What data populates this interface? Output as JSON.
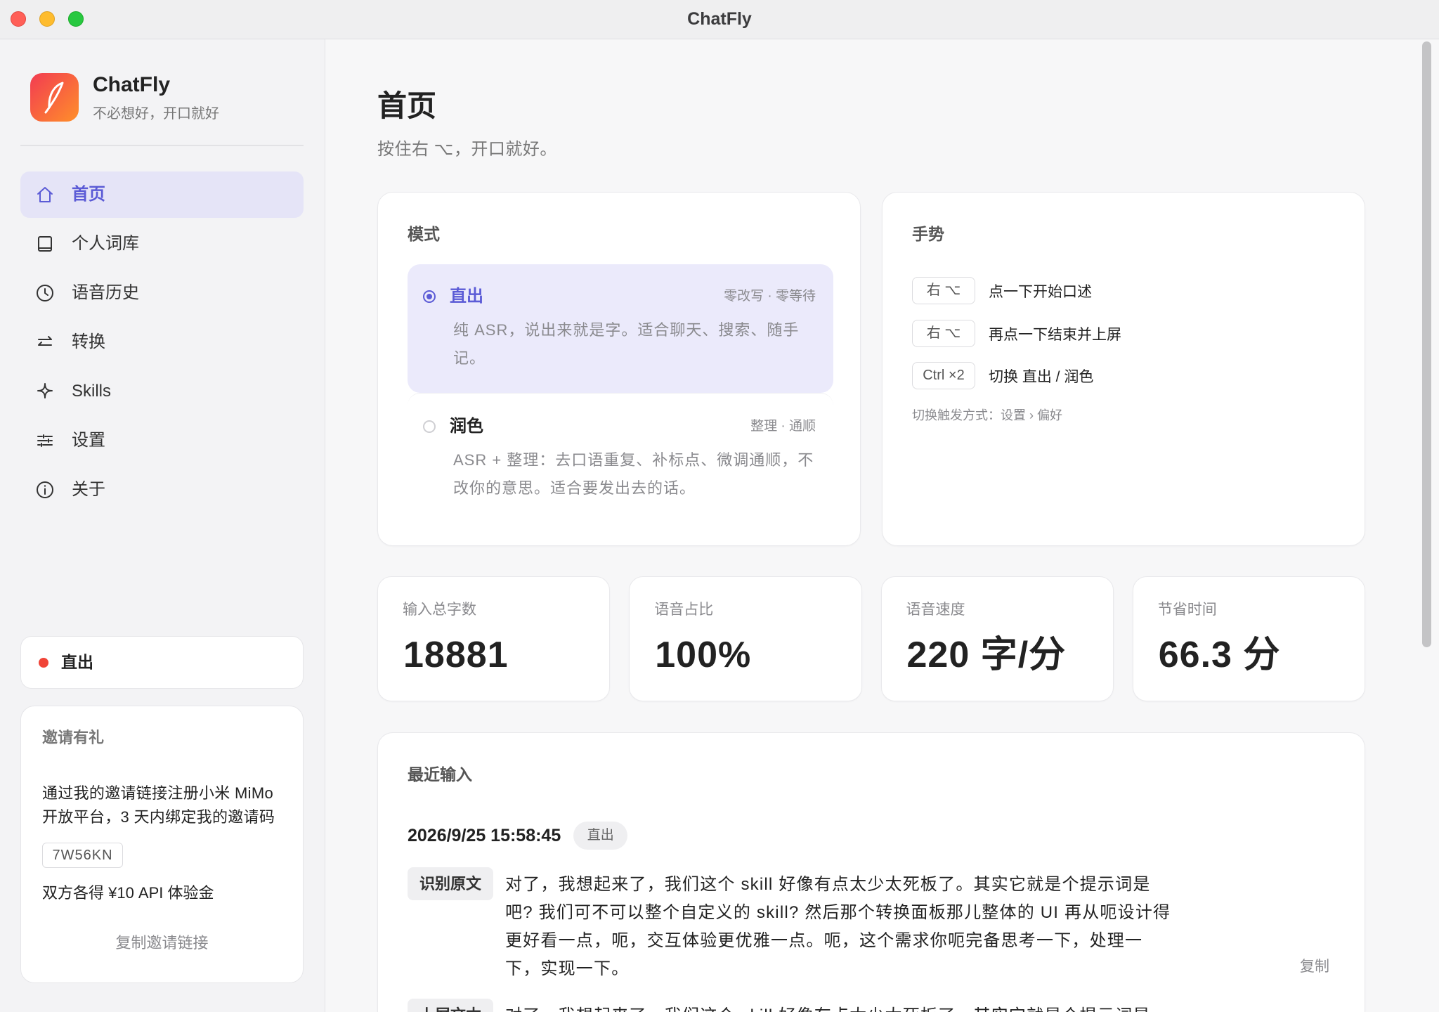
{
  "window": {
    "title": "ChatFly"
  },
  "colors": {
    "accent": "#5b5bd6",
    "selected_bg": "#ebeafb",
    "status_dot": "#f04438",
    "logo_start": "#f23b52",
    "logo_end": "#ff8f2a",
    "traffic_red": "#ff5f57",
    "traffic_yellow": "#febc2e",
    "traffic_green": "#28c840"
  },
  "sidebar": {
    "logo_icon": "feather-icon",
    "app_name": "ChatFly",
    "tagline": "不必想好，开口就好",
    "nav": [
      {
        "label": "首页",
        "icon": "home-icon",
        "active": true
      },
      {
        "label": "个人词库",
        "icon": "book-icon"
      },
      {
        "label": "语音历史",
        "icon": "clock-icon"
      },
      {
        "label": "转换",
        "icon": "swap-arrows-icon"
      },
      {
        "label": "Skills",
        "icon": "sparkle-icon"
      },
      {
        "label": "设置",
        "icon": "sliders-icon"
      },
      {
        "label": "关于",
        "icon": "info-icon"
      }
    ],
    "status": {
      "label": "直出"
    },
    "invite": {
      "title": "邀请有礼",
      "body": "通过我的邀请链接注册小米 MiMo 开放平台，3 天内绑定我的邀请码",
      "code": "7W56KN",
      "reward": "双方各得 ¥10 API 体验金",
      "copy_link_label": "复制邀请链接"
    }
  },
  "main": {
    "title": "首页",
    "subtitle": "按住右 ⌥，开口就好。",
    "mode": {
      "title": "模式",
      "options": [
        {
          "title": "直出",
          "meta": "零改写 · 零等待",
          "desc": "纯 ASR，说出来就是字。适合聊天、搜索、随手记。",
          "selected": true
        },
        {
          "title": "润色",
          "meta": "整理 · 通顺",
          "desc": "ASR + 整理：去口语重复、补标点、微调通顺，不改你的意思。适合要发出去的话。",
          "selected": false
        }
      ]
    },
    "gestures": {
      "title": "手势",
      "rows": [
        {
          "key": "右 ⌥",
          "label": "点一下开始口述"
        },
        {
          "key": "右 ⌥",
          "label": "再点一下结束并上屏"
        },
        {
          "key": "Ctrl ×2",
          "label": "切换 直出 / 润色"
        }
      ],
      "note": "切换触发方式：设置 › 偏好"
    },
    "stats": [
      {
        "label": "输入总字数",
        "value": "18881"
      },
      {
        "label": "语音占比",
        "value": "100%"
      },
      {
        "label": "语音速度",
        "value": "220 字/分"
      },
      {
        "label": "节省时间",
        "value": "66.3 分"
      }
    ],
    "recent": {
      "title": "最近输入",
      "entries": [
        {
          "time": "2026/9/25 15:58:45",
          "mode": "直出",
          "raw_label": "识别原文",
          "raw_text": "对了，我想起来了，我们这个 skill 好像有点太少太死板了。其实它就是个提示词是吧? 我们可不可以整个自定义的 skill? 然后那个转换面板那儿整体的 UI 再从呃设计得更好看一点，呃，交互体验更优雅一点。呃，这个需求你呃完备思考一下，处理一下，实现一下。",
          "copy_label": "复制",
          "output_label": "上屏文本",
          "output_text": "对了，我想起来了，我们这个 skill 好像有点太少太死板了。其实它就是个提示词是吧?"
        }
      ]
    }
  }
}
